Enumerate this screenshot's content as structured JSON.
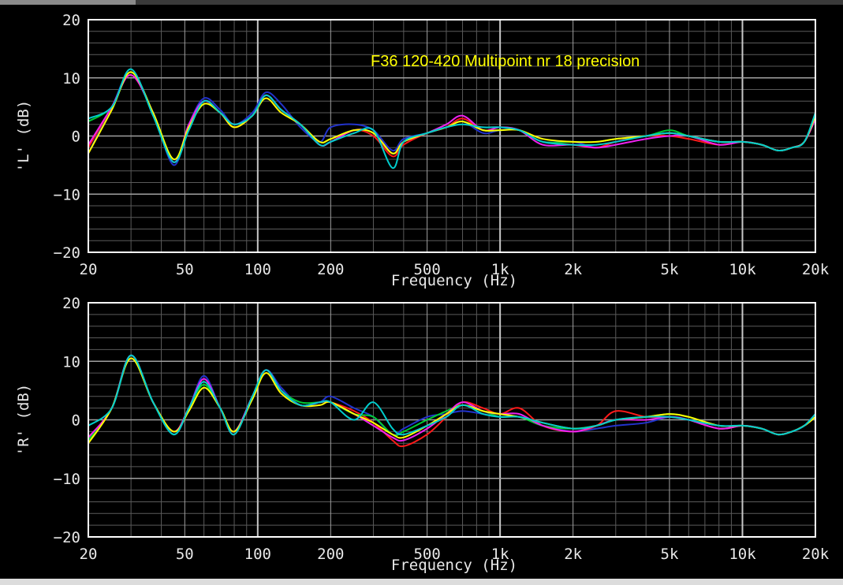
{
  "annotation": "F36 120-420 Multipoint  nr 18 precision",
  "colors": {
    "background": "#000000",
    "grid_major": "#a0a0a0",
    "grid_minor": "#5a5a5a",
    "frame": "#ffffff",
    "text": "#e8e8e8",
    "annotation": "#ffff00"
  },
  "chart_data": [
    {
      "type": "line",
      "xlabel": "Frequency (Hz)",
      "ylabel": "'L' (dB)",
      "xscale": "log",
      "xlim": [
        20,
        20000
      ],
      "ylim": [
        -20,
        20
      ],
      "grid": true,
      "x_ticks": [
        20,
        50,
        100,
        200,
        500,
        1000,
        2000,
        5000,
        10000,
        20000
      ],
      "x_tick_labels": [
        "20",
        "50",
        "100",
        "200",
        "500",
        "1k",
        "2k",
        "5k",
        "10k",
        "20k"
      ],
      "y_ticks": [
        20,
        10,
        0,
        -10,
        -20
      ],
      "y_tick_labels": [
        "20",
        "10",
        "0",
        "−10",
        "−20"
      ],
      "x": [
        20,
        25,
        30,
        37,
        45,
        52,
        60,
        70,
        80,
        95,
        108,
        125,
        150,
        180,
        200,
        250,
        300,
        360,
        400,
        500,
        600,
        700,
        850,
        1000,
        1200,
        1500,
        2000,
        2500,
        3000,
        4000,
        5000,
        6000,
        8000,
        10000,
        12000,
        14000,
        16000,
        18000,
        20000
      ],
      "series": [
        {
          "color": "#2233cc",
          "values": [
            -3,
            5,
            11,
            4,
            -5,
            2,
            6.5,
            4.5,
            2,
            4,
            7.5,
            5.5,
            1.5,
            -1,
            1.5,
            2,
            1,
            -2.5,
            -0.5,
            0.5,
            1.5,
            2.5,
            0.5,
            1,
            1,
            -1,
            -1,
            -2,
            -1,
            0,
            0.5,
            0,
            -1,
            -1,
            -1.5,
            -2.5,
            -2,
            -1,
            3
          ]
        },
        {
          "color": "#ff1a1a",
          "values": [
            -2,
            5,
            10.5,
            4,
            -4.5,
            1.5,
            6,
            4,
            1.5,
            3.5,
            7,
            4.5,
            2,
            -1.5,
            -1,
            1,
            0,
            -3.5,
            -1.5,
            0.5,
            1.5,
            3,
            1,
            1.5,
            1,
            -1,
            -1.5,
            -2,
            -1,
            0,
            0,
            -0.5,
            -1.5,
            -1,
            -1.5,
            -2.5,
            -2,
            -1,
            3
          ]
        },
        {
          "color": "#00cc33",
          "values": [
            2.5,
            5,
            11,
            4,
            -4,
            1.5,
            5.5,
            4,
            2,
            3.5,
            7,
            4.5,
            2,
            -1,
            -0.5,
            1,
            0.5,
            -3,
            -1,
            0.5,
            1.5,
            2.5,
            1,
            1,
            1,
            -1,
            -1,
            -1,
            -0.5,
            0,
            1,
            0,
            -1,
            -1,
            -1.5,
            -2.5,
            -2,
            -1,
            3.5
          ]
        },
        {
          "color": "#ee22ee",
          "values": [
            -1.5,
            5,
            10.5,
            4,
            -4.5,
            2,
            6,
            4,
            2,
            3.5,
            7,
            4.5,
            2,
            -1.5,
            -1,
            1,
            0.5,
            -3,
            -1,
            0.5,
            2,
            3.5,
            1,
            1.5,
            1,
            -1.5,
            -1.5,
            -2,
            -1.5,
            -0.5,
            0,
            0,
            -1.5,
            -1,
            -1.5,
            -2.5,
            -2,
            -1,
            3
          ]
        },
        {
          "color": "#ffff00",
          "values": [
            -3,
            4.5,
            11,
            4,
            -4,
            1.5,
            5.5,
            4,
            1.5,
            3.5,
            6.5,
            4,
            2,
            -1,
            -0.5,
            1,
            0.5,
            -3,
            -1,
            0.5,
            1.5,
            2.5,
            1,
            1,
            1,
            -0.5,
            -1,
            -1,
            -0.5,
            0,
            0.5,
            0,
            -1,
            -1,
            -1.5,
            -2.5,
            -2,
            -1,
            3.5
          ]
        },
        {
          "color": "#00cccc",
          "values": [
            3,
            5,
            11.5,
            3.5,
            -4.5,
            1,
            6,
            4,
            2,
            3.5,
            7,
            4.5,
            2,
            -1.5,
            -1,
            0.5,
            1,
            -5.5,
            -1,
            0.5,
            1.5,
            2,
            1.5,
            1.5,
            1,
            -1,
            -1.5,
            -1.5,
            -1,
            0,
            0.5,
            0,
            -1,
            -1,
            -1.5,
            -2.5,
            -2,
            -1,
            4
          ]
        }
      ]
    },
    {
      "type": "line",
      "xlabel": "Frequency (Hz)",
      "ylabel": "'R' (dB)",
      "xscale": "log",
      "xlim": [
        20,
        20000
      ],
      "ylim": [
        -20,
        20
      ],
      "grid": true,
      "x_ticks": [
        20,
        50,
        100,
        200,
        500,
        1000,
        2000,
        5000,
        10000,
        20000
      ],
      "x_tick_labels": [
        "20",
        "50",
        "100",
        "200",
        "500",
        "1k",
        "2k",
        "5k",
        "10k",
        "20k"
      ],
      "y_ticks": [
        20,
        10,
        0,
        -10,
        -20
      ],
      "y_tick_labels": [
        "20",
        "10",
        "0",
        "−10",
        "−20"
      ],
      "x": [
        20,
        25,
        30,
        37,
        45,
        52,
        60,
        70,
        80,
        95,
        108,
        125,
        150,
        180,
        200,
        250,
        300,
        360,
        400,
        500,
        600,
        700,
        850,
        1000,
        1200,
        1500,
        2000,
        2500,
        3000,
        4000,
        5000,
        6000,
        8000,
        10000,
        12000,
        14000,
        16000,
        18000,
        20000
      ],
      "series": [
        {
          "color": "#2233cc",
          "values": [
            -3.5,
            2,
            11,
            3,
            -2.5,
            2,
            7.5,
            2,
            -2,
            4,
            8.5,
            5.5,
            2.5,
            3,
            4,
            2,
            0.5,
            -2.5,
            -1.5,
            0.5,
            1,
            1.5,
            1,
            0.5,
            0.5,
            -1,
            -2,
            -1.5,
            -1,
            -0.5,
            0.5,
            0,
            -1.5,
            -1,
            -1.5,
            -2.5,
            -2,
            -1,
            1
          ]
        },
        {
          "color": "#ff1a1a",
          "values": [
            -3,
            2,
            11,
            3,
            -2,
            2,
            6.5,
            2,
            -2.5,
            4,
            8.5,
            5,
            2.5,
            3,
            3,
            1.5,
            -0.5,
            -3.5,
            -4.5,
            -2.5,
            0.5,
            3,
            2,
            1,
            2,
            -1,
            -2,
            -1,
            1.5,
            0.5,
            0.5,
            0,
            -1.5,
            -1,
            -1.5,
            -2.5,
            -2,
            -1,
            0.5
          ]
        },
        {
          "color": "#00cc33",
          "values": [
            -3.5,
            2,
            11,
            3,
            -2.5,
            2,
            6,
            2,
            -2,
            4,
            8.5,
            5,
            3,
            3,
            3,
            1,
            0.5,
            -2.5,
            -2,
            0,
            1.5,
            2.5,
            1.5,
            0.5,
            0.5,
            -1,
            -1.5,
            -1,
            0,
            0.5,
            1,
            0.5,
            -1,
            -1,
            -1.5,
            -2.5,
            -2,
            -1,
            0.5
          ]
        },
        {
          "color": "#ee22ee",
          "values": [
            -3,
            2,
            11,
            3,
            -2,
            2,
            7,
            2,
            -2,
            4,
            8.5,
            5,
            2.5,
            3,
            3,
            1,
            -1,
            -3,
            -3.5,
            -1.5,
            1,
            3,
            1.5,
            1,
            1,
            -1,
            -2,
            -1,
            0,
            0,
            0.5,
            0,
            -1.5,
            -1,
            -1.5,
            -2.5,
            -2,
            -1,
            0.5
          ]
        },
        {
          "color": "#ffff00",
          "values": [
            -4,
            2,
            10.5,
            3,
            -2,
            1.5,
            5.5,
            2,
            -2,
            3.5,
            8,
            4.5,
            2.5,
            2.5,
            3,
            1,
            -0.5,
            -2.5,
            -3,
            -1,
            1,
            2.5,
            1.5,
            1,
            0.5,
            -0.5,
            -1.5,
            -1,
            0,
            0.5,
            1,
            0.5,
            -1,
            -1,
            -1.5,
            -2.5,
            -2,
            -1,
            0.5
          ]
        },
        {
          "color": "#00cccc",
          "values": [
            -1,
            2,
            11,
            3,
            -2.5,
            2,
            6.5,
            2,
            -2.5,
            4,
            8.5,
            5,
            2.5,
            3,
            3,
            0,
            3,
            -1.5,
            -2.5,
            -1,
            0.5,
            2.5,
            1,
            0.5,
            0.5,
            -0.5,
            -1.5,
            -1,
            0,
            0.5,
            0.5,
            0,
            -1,
            -1,
            -1.5,
            -2.5,
            -2,
            -1,
            1
          ]
        }
      ]
    }
  ]
}
